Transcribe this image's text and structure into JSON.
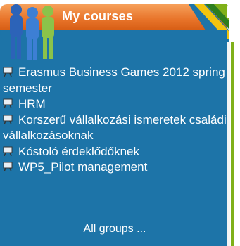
{
  "block": {
    "title": "My courses",
    "icons": {
      "header": "people-icon",
      "collapse": "minus-icon",
      "course": "presentation-board-icon"
    },
    "colors": {
      "header": "#e8742a",
      "content": "#1d74a8",
      "accent_green": "#7fb019",
      "text": "#ffffff"
    }
  },
  "courses": [
    {
      "label": "Erasmus Business Games 2012 spring semester"
    },
    {
      "label": "HRM"
    },
    {
      "label": "Korszerű vállalkozási ismeretek családi vállalkozásoknak"
    },
    {
      "label": "Kóstoló érdeklődőknek"
    },
    {
      "label": "WP5_Pilot management"
    }
  ],
  "footer": {
    "all_groups": "All groups ..."
  }
}
